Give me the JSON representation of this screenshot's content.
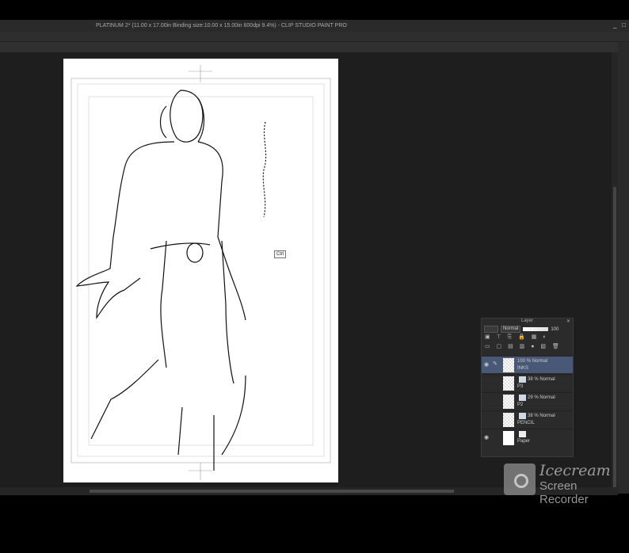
{
  "window": {
    "title": "PLATINUM 2* (11.00 x 17.00in Binding size:10.00 x 15.00in 600dpi 9.4%) - CLIP STUDIO PAINT PRO",
    "minimize": "_",
    "maximize": "□"
  },
  "canvas": {
    "tooltip": "Ctrl"
  },
  "layer_panel": {
    "title": "Layer",
    "close": "✕",
    "blend_mode": "Normal",
    "opacity": "100",
    "layers": [
      {
        "mode": "100 % Normal",
        "name": "INKS",
        "active": true,
        "visible": true
      },
      {
        "mode": "38 % Normal",
        "name": "P3",
        "active": false,
        "visible": false
      },
      {
        "mode": "29 % Normal",
        "name": "P2",
        "active": false,
        "visible": false
      },
      {
        "mode": "38 % Normal",
        "name": "PENCIL",
        "active": false,
        "visible": false
      },
      {
        "mode": "",
        "name": "Paper",
        "active": false,
        "visible": true
      }
    ]
  },
  "watermark": {
    "line1": "Icecream",
    "line2": "Screen Recorder"
  }
}
